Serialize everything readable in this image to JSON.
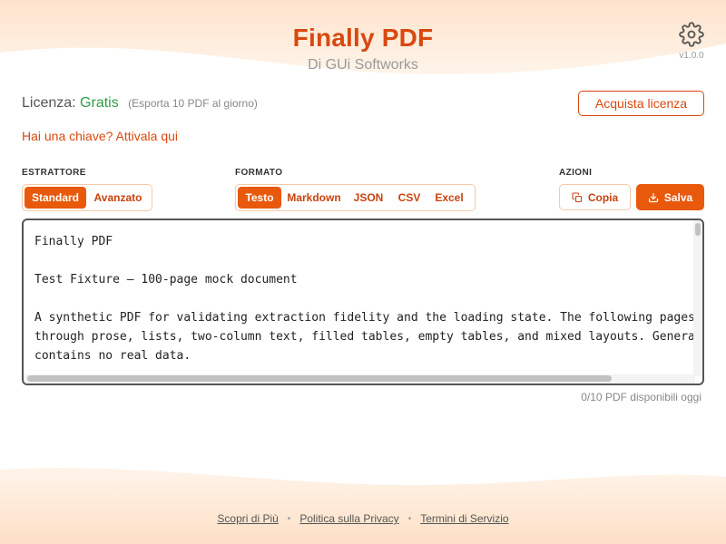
{
  "app": {
    "title": "Finally PDF",
    "subtitle": "Di GUi Softworks",
    "version": "v1.0.0",
    "accent_color": "#d9480f"
  },
  "settings": {
    "icon": "gear-icon"
  },
  "license": {
    "label": "Licenza:",
    "status": "Gratis",
    "status_color": "#2f9e44",
    "note": "(Esporta 10 PDF al giorno)",
    "buy_label": "Acquista licenza",
    "activate_label": "Hai una chiave? Attivala qui"
  },
  "extractor": {
    "label": "ESTRATTORE",
    "options": [
      "Standard",
      "Avanzato"
    ],
    "selected": "Standard"
  },
  "format": {
    "label": "FORMATO",
    "options": [
      "Testo",
      "Markdown",
      "JSON",
      "CSV",
      "Excel"
    ],
    "selected": "Testo"
  },
  "actions": {
    "label": "AZIONI",
    "copy_label": "Copia",
    "copy_icon": "copy-icon",
    "save_label": "Salva",
    "save_icon": "download-icon"
  },
  "output": {
    "text": "Finally PDF\n\nTest Fixture — 100-page mock document\n\nA synthetic PDF for validating extraction fidelity and the loading state. The following pages\nthrough prose, lists, two-column text, filled tables, empty tables, and mixed layouts. Genera\ncontains no real data."
  },
  "usage": {
    "available_text": "0/10 PDF disponibili oggi"
  },
  "footer": {
    "links": [
      "Scopri di Più",
      "Politica sulla Privacy",
      "Termini di Servizio"
    ]
  }
}
